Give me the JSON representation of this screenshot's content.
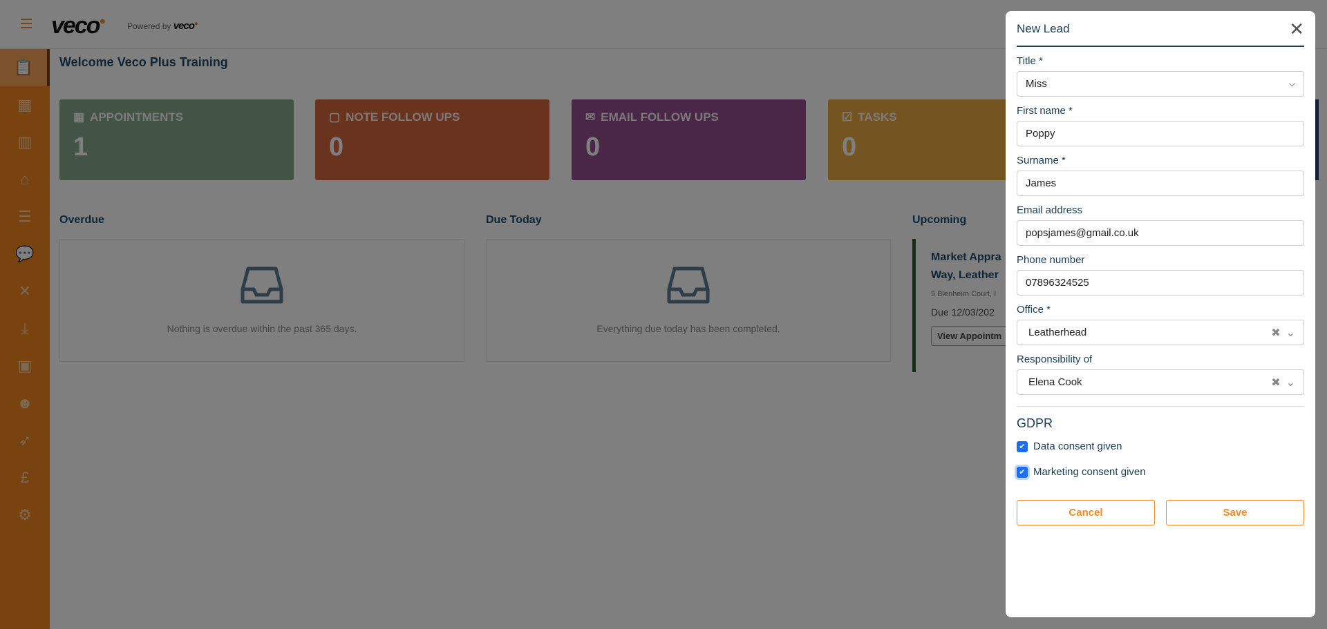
{
  "header": {
    "logo": "veco",
    "powered_by": "Powered by",
    "powered_logo": "veco"
  },
  "sidebar": {
    "items": [
      {
        "icon": "clipboard-check-icon",
        "glyph": "📋"
      },
      {
        "icon": "calendar-icon",
        "glyph": "▦"
      },
      {
        "icon": "building-icon",
        "glyph": "▥"
      },
      {
        "icon": "house-user-icon",
        "glyph": "⌂"
      },
      {
        "icon": "list-check-icon",
        "glyph": "☰"
      },
      {
        "icon": "message-alert-icon",
        "glyph": "💬"
      },
      {
        "icon": "tools-icon",
        "glyph": "✕"
      },
      {
        "icon": "download-tray-icon",
        "glyph": "⤓"
      },
      {
        "icon": "contact-book-icon",
        "glyph": "▣"
      },
      {
        "icon": "worker-icon",
        "glyph": "☻"
      },
      {
        "icon": "rocket-icon",
        "glyph": "➶"
      },
      {
        "icon": "pound-icon",
        "glyph": "£"
      },
      {
        "icon": "gear-icon",
        "glyph": "⚙"
      }
    ]
  },
  "welcome": "Welcome Veco Plus Training",
  "cards": [
    {
      "label": "APPOINTMENTS",
      "value": "1",
      "icon": "▦",
      "color": "#86a88c"
    },
    {
      "label": "NOTE FOLLOW UPS",
      "value": "0",
      "icon": "▢",
      "color": "#d4663a"
    },
    {
      "label": "EMAIL FOLLOW UPS",
      "value": "0",
      "icon": "✉",
      "color": "#944f8f"
    },
    {
      "label": "TASKS",
      "value": "0",
      "icon": "☑",
      "color": "#e8a840"
    }
  ],
  "sections": {
    "overdue": {
      "title": "Overdue",
      "message": "Nothing is overdue within the past 365 days."
    },
    "due_today": {
      "title": "Due Today",
      "message": "Everything due today has been completed."
    },
    "upcoming": {
      "title": "Upcoming",
      "item": {
        "title_line1": "Market Appra",
        "title_line2": "Way, Leather",
        "address": "5 Blenheim Court, I",
        "due": "Due 12/03/202",
        "button": "View Appointm"
      }
    }
  },
  "modal": {
    "title": "New Lead",
    "fields": {
      "title": {
        "label": "Title *",
        "value": "Miss"
      },
      "first_name": {
        "label": "First name *",
        "value": "Poppy"
      },
      "surname": {
        "label": "Surname *",
        "value": "James"
      },
      "email": {
        "label": "Email address",
        "value": "popsjames@gmail.co.uk"
      },
      "phone": {
        "label": "Phone number",
        "value": "07896324525"
      },
      "office": {
        "label": "Office *",
        "value": "Leatherhead"
      },
      "responsibility": {
        "label": "Responsibility of",
        "value": "Elena Cook"
      }
    },
    "gdpr": {
      "heading": "GDPR",
      "data_consent": {
        "label": "Data consent given",
        "checked": true
      },
      "marketing_consent": {
        "label": "Marketing consent given",
        "checked": true
      }
    },
    "cancel": "Cancel",
    "save": "Save"
  }
}
